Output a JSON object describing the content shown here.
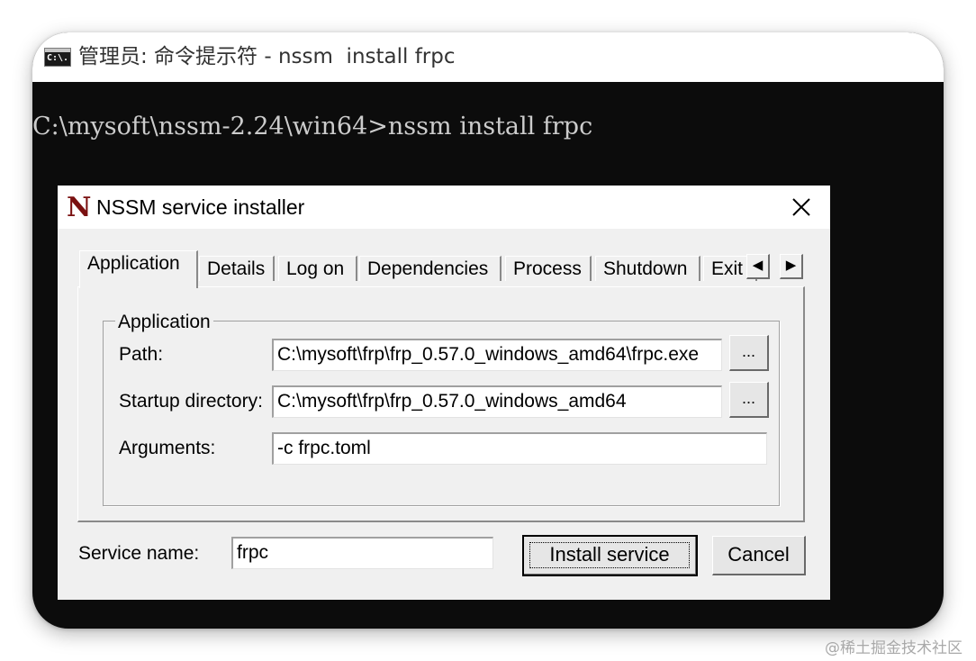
{
  "console": {
    "title": "管理员: 命令提示符 - nssm  install frpc",
    "icon_text": "C:\\.",
    "prompt_line": "C:\\mysoft\\nssm-2.24\\win64>nssm install frpc"
  },
  "dialog": {
    "title": "NSSM service installer",
    "icon_letter": "N",
    "tabs": [
      "Application",
      "Details",
      "Log on",
      "Dependencies",
      "Process",
      "Shutdown",
      "Exit"
    ],
    "active_tab": "Application",
    "group_title": "Application",
    "fields": {
      "path": {
        "label": "Path:",
        "value": "C:\\mysoft\\frp\\frp_0.57.0_windows_amd64\\frpc.exe"
      },
      "startup_directory": {
        "label": "Startup directory:",
        "value": "C:\\mysoft\\frp\\frp_0.57.0_windows_amd64"
      },
      "arguments": {
        "label": "Arguments:",
        "value": "-c frpc.toml"
      }
    },
    "browse_label": "...",
    "service_name": {
      "label": "Service name:",
      "value": "frpc"
    },
    "buttons": {
      "install": "Install service",
      "cancel": "Cancel"
    }
  },
  "watermark": "@稀土掘金技术社区",
  "colors": {
    "console_bg": "#0c0c0c",
    "console_text": "#cccccc",
    "dialog_bg": "#f0f0f0",
    "icon_red": "#7a1010"
  }
}
